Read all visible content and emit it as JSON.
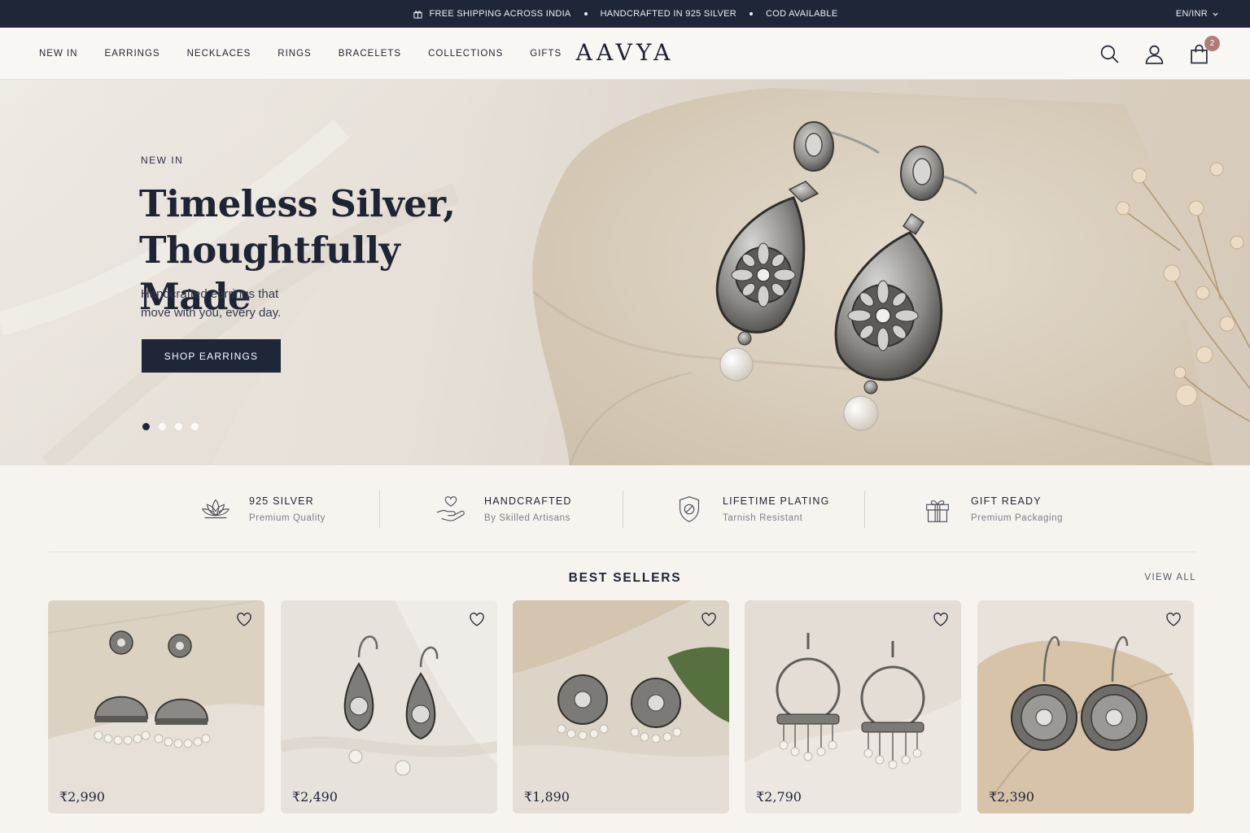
{
  "topbar": {
    "messages": [
      "FREE SHIPPING ACROSS INDIA",
      "HANDCRAFTED IN 925 SILVER",
      "COD AVAILABLE"
    ],
    "locale": "EN/INR"
  },
  "header": {
    "nav": [
      "NEW IN",
      "EARRINGS",
      "NECKLACES",
      "RINGS",
      "BRACELETS",
      "COLLECTIONS",
      "GIFTS"
    ],
    "logo": "AAVYA",
    "cart_count": "2",
    "icons": [
      "search-icon",
      "account-icon",
      "cart-icon"
    ]
  },
  "hero": {
    "eyebrow": "NEW IN",
    "title_line1": "Timeless Silver,",
    "title_line2": "Thoughtfully Made",
    "subtitle_line1": "Handcrafted earrings that",
    "subtitle_line2": "move with you, every day.",
    "cta": "SHOP EARRINGS",
    "slide_count": 4,
    "active_slide": 1
  },
  "features": [
    {
      "title": "925 SILVER",
      "subtitle": "Premium Quality",
      "icon": "lotus-icon"
    },
    {
      "title": "HANDCRAFTED",
      "subtitle": "By Skilled Artisans",
      "icon": "hand-heart-icon"
    },
    {
      "title": "LIFETIME PLATING",
      "subtitle": "Tarnish Resistant",
      "icon": "shield-icon"
    },
    {
      "title": "GIFT READY",
      "subtitle": "Premium Packaging",
      "icon": "gift-icon"
    }
  ],
  "best_sellers": {
    "title": "BEST SELLERS",
    "view_all": "VIEW ALL",
    "products": [
      {
        "price": "₹2,990"
      },
      {
        "price": "₹2,490"
      },
      {
        "price": "₹1,890"
      },
      {
        "price": "₹2,790"
      },
      {
        "price": "₹2,390"
      }
    ]
  },
  "colors": {
    "navy": "#1f2638",
    "background": "#f7f4f0",
    "badge": "#b07c78"
  }
}
